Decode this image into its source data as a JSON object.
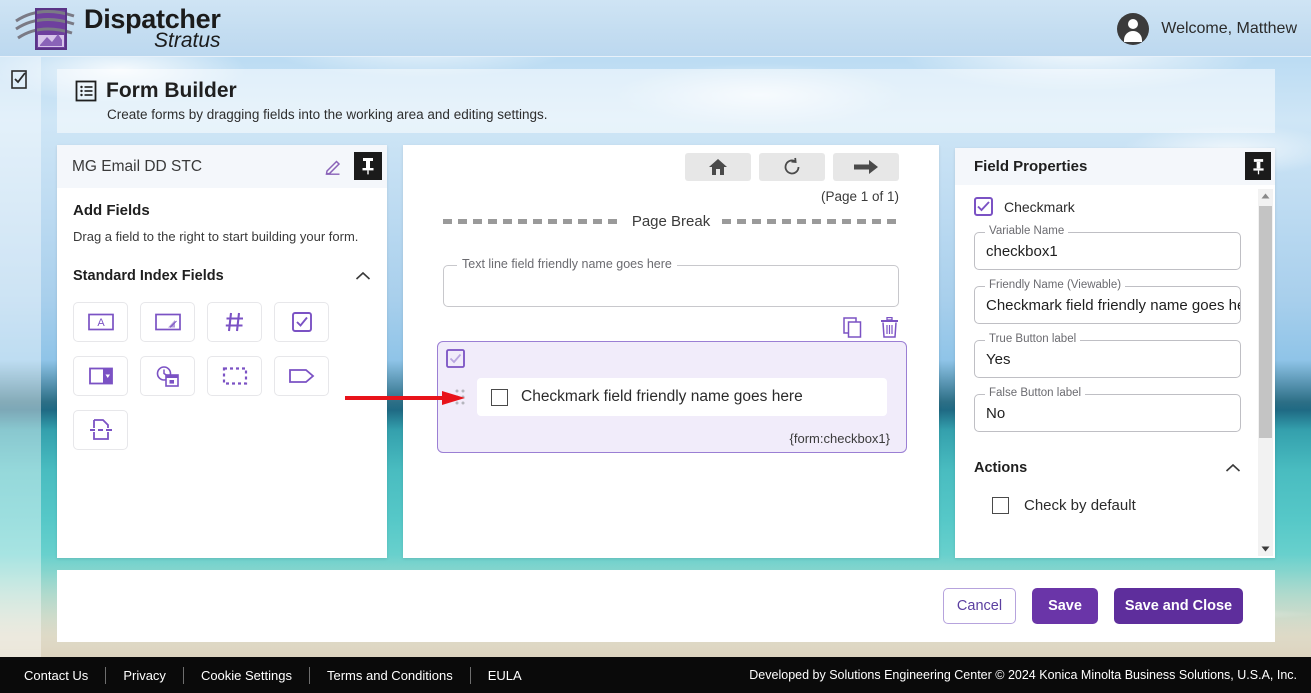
{
  "header": {
    "logo_title": "Dispatcher",
    "logo_subtitle": "Stratus",
    "logo_icon": "stratus-logo-icon",
    "avatar_icon": "user-avatar-icon",
    "welcome": "Welcome, Matthew"
  },
  "page": {
    "icon": "form-list-icon",
    "title": "Form Builder",
    "subtitle": "Create forms by dragging fields into the working area and editing settings."
  },
  "rail": {
    "icon": "checkbox-form-icon"
  },
  "left_panel": {
    "form_name": "MG Email DD STC",
    "edit_icon": "pencil-edit-icon",
    "pin_icon": "pin-icon",
    "add_fields_heading": "Add Fields",
    "hint": "Drag a field to the right to start building your form.",
    "section_title": "Standard Index Fields",
    "collapse_icon": "chevron-up-icon",
    "field_types": [
      {
        "name": "text-line-field",
        "icon": "text-line-icon"
      },
      {
        "name": "text-area-field",
        "icon": "text-area-icon"
      },
      {
        "name": "number-field",
        "icon": "hash-number-icon"
      },
      {
        "name": "checkmark-field",
        "icon": "checkmark-icon"
      },
      {
        "name": "dropdown-field",
        "icon": "dropdown-icon"
      },
      {
        "name": "date-time-field",
        "icon": "date-time-icon"
      },
      {
        "name": "group-field",
        "icon": "dotted-group-icon"
      },
      {
        "name": "label-field",
        "icon": "tag-label-icon"
      },
      {
        "name": "page-break-field",
        "icon": "page-break-icon"
      }
    ]
  },
  "canvas": {
    "toolbar": [
      {
        "name": "home-button",
        "icon": "home-icon"
      },
      {
        "name": "refresh-button",
        "icon": "refresh-icon"
      },
      {
        "name": "next-page-button",
        "icon": "arrow-right-icon"
      }
    ],
    "page_count": "(Page 1 of 1)",
    "page_break_label": "Page Break",
    "text_field_legend": "Text line field friendly name goes here",
    "copy_icon": "copy-icon",
    "delete_icon": "trash-delete-icon",
    "selected_field": {
      "type_icon": "checkmark-type-icon",
      "drag_icon": "drag-handle-icon",
      "label": "Checkmark field friendly name goes here",
      "variable_token": "{form:checkbox1}"
    }
  },
  "right_panel": {
    "title": "Field Properties",
    "pin_icon": "pin-icon",
    "field_type_label": "Checkmark",
    "field_type_icon": "checkmark-icon",
    "fields": [
      {
        "legend": "Variable Name",
        "value": "checkbox1",
        "name": "variable-name-input"
      },
      {
        "legend": "Friendly Name (Viewable)",
        "value": "Checkmark field friendly name goes here",
        "name": "friendly-name-input"
      },
      {
        "legend": "True Button label",
        "value": "Yes",
        "name": "true-button-label-input"
      },
      {
        "legend": "False Button label",
        "value": "No",
        "name": "false-button-label-input"
      }
    ],
    "actions_title": "Actions",
    "actions_collapse_icon": "chevron-up-icon",
    "action_checkbox_label": "Check by default"
  },
  "action_bar": {
    "cancel": "Cancel",
    "save": "Save",
    "save_and_close": "Save and Close"
  },
  "footer": {
    "links": [
      "Contact Us",
      "Privacy",
      "Cookie Settings",
      "Terms and Conditions",
      "EULA"
    ],
    "copyright": "Developed by Solutions Engineering Center © 2024 Konica Minolta Business Solutions, U.S.A, Inc."
  },
  "colors": {
    "accent_purple": "#6a35a8",
    "accent_purple_dark": "#5e2e9c",
    "field_icon_purple": "#7b52c4",
    "selected_bg": "#f1ecfa",
    "annotation_red": "#e8131a"
  }
}
